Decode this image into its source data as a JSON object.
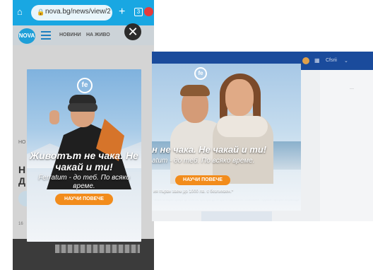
{
  "phone": {
    "browser": {
      "url": "nova.bg/news/view/2",
      "plus": "+",
      "tabs_count": "3"
    },
    "site": {
      "logo": "NOVA",
      "nav": [
        "НОВИНИ",
        "НА ЖИВО"
      ],
      "close": "✕"
    },
    "background": {
      "crumb": "НО",
      "headline_line1": "Н",
      "headline_line2": "Д",
      "footer_text": "16"
    },
    "ad": {
      "brand_mark": "fe",
      "headline": "Животът не чака. Не чакай и ти!",
      "subline": "Ferratum - до теб. По всяко време.",
      "cta": "НАУЧИ ПОВЕЧЕ"
    }
  },
  "desktop": {
    "header": {
      "user": "Cfsrii",
      "caret": "⌄"
    },
    "sidebar_text": "···",
    "ad": {
      "brand_mark": "fe",
      "headline": "н не чака. Не чакай и ти!",
      "subline": "atum - до теб. По всяко време.",
      "cta": "НАУЧИ ПОВЕЧЕ",
      "promo": "ия първи заем до 1000 лв. с безлихвен.*",
      "fine_print": "*Важи за първи кредит до 1000 лв. при срок до 30 дни и навременно погасяване. Годишен процент на разходите (ГПР) 0%. Подробности и условия на сайта на Феротум България"
    }
  },
  "colors": {
    "phone_browser_bar": "#19a7e2",
    "desktop_header": "#1a4b9c",
    "cta_orange": "#f28c1c",
    "nova_blue": "#1e9fd8"
  }
}
